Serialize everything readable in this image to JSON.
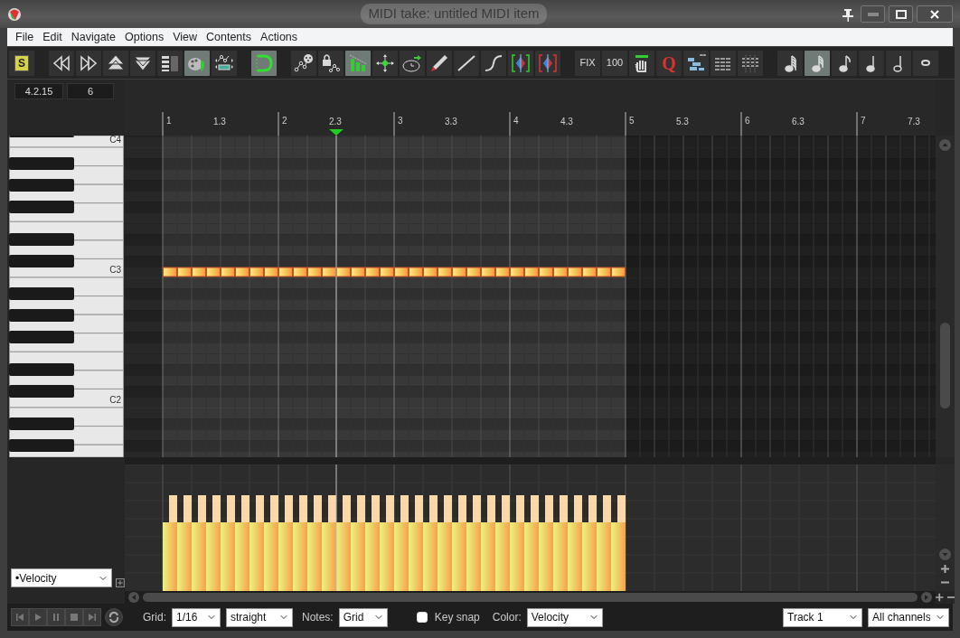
{
  "window": {
    "title": "MIDI take: untitled MIDI item"
  },
  "menu": [
    "File",
    "Edit",
    "Navigate",
    "Options",
    "View",
    "Contents",
    "Actions"
  ],
  "toolbar": {
    "groups": [
      [
        {
          "label": "S",
          "selected": false
        }
      ],
      [
        {
          "selected": false
        },
        {
          "selected": false
        },
        {
          "selected": false
        },
        {
          "selected": false
        },
        {
          "selected": false
        },
        {
          "selected": true
        },
        {
          "selected": false
        }
      ],
      [
        {
          "selected": true
        }
      ],
      [
        {
          "selected": false
        },
        {
          "selected": false
        },
        {
          "selected": true
        },
        {
          "selected": false
        },
        {
          "selected": false
        },
        {
          "selected": false
        },
        {
          "selected": false
        },
        {
          "selected": false
        },
        {
          "selected": false
        },
        {
          "selected": false
        }
      ],
      [
        {
          "label": "FIX",
          "selected": false
        },
        {
          "label": "100",
          "selected": false
        },
        {
          "selected": false
        },
        {
          "label": "Q",
          "selected": false
        },
        {
          "selected": false
        },
        {
          "selected": false
        },
        {
          "selected": false
        }
      ],
      [
        {
          "selected": false
        },
        {
          "selected": true
        },
        {
          "selected": false
        },
        {
          "selected": false
        },
        {
          "selected": false
        },
        {
          "selected": false
        }
      ]
    ]
  },
  "position": {
    "time": "4.2.15",
    "value": "6"
  },
  "ruler": [
    {
      "label": "1",
      "kind": "bar",
      "playhead": false
    },
    {
      "label": "1.3",
      "kind": "beat",
      "playhead": false
    },
    {
      "label": "2",
      "kind": "bar",
      "playhead": false
    },
    {
      "label": "2.3",
      "kind": "beat",
      "playhead": true
    },
    {
      "label": "3",
      "kind": "bar",
      "playhead": false
    },
    {
      "label": "3.3",
      "kind": "beat",
      "playhead": false
    },
    {
      "label": "4",
      "kind": "bar",
      "playhead": false
    },
    {
      "label": "4.3",
      "kind": "beat",
      "playhead": false
    },
    {
      "label": "5",
      "kind": "bar",
      "playhead": false
    },
    {
      "label": "5.3",
      "kind": "beat",
      "playhead": false
    },
    {
      "label": "6",
      "kind": "bar",
      "playhead": false
    },
    {
      "label": "6.3",
      "kind": "beat",
      "playhead": false
    },
    {
      "label": "7",
      "kind": "bar",
      "playhead": false
    },
    {
      "label": "7.3",
      "kind": "beat",
      "playhead": false
    }
  ],
  "piano": {
    "labels": [
      "C4",
      "C3",
      "C2"
    ]
  },
  "cc_lane": {
    "value": "•Velocity"
  },
  "bottom_bar": {
    "grid": {
      "label": "Grid:",
      "value": "1/16",
      "type": "straight"
    },
    "notes": {
      "label": "Notes:",
      "value": "Grid"
    },
    "key_snap": {
      "label": "Key snap",
      "checked": false
    },
    "color": {
      "label": "Color:",
      "value": "Velocity"
    },
    "track": "Track 1",
    "channels": "All channels"
  }
}
